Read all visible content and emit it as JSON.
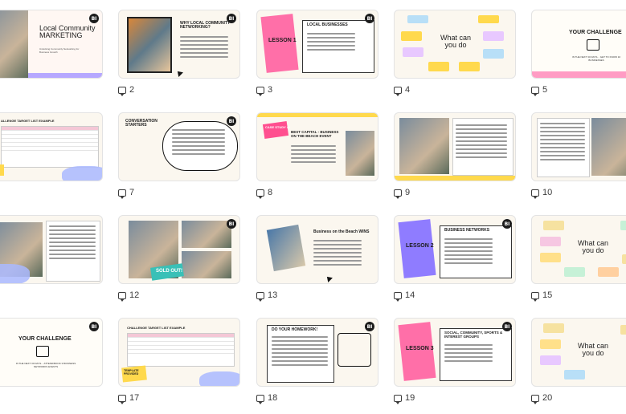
{
  "slides": [
    {
      "num": "",
      "title": "Local Community MARKETING",
      "subtitle": "Unlocking Community Networking for Business Growth",
      "kind": "cover"
    },
    {
      "num": "2",
      "title": "WHY LOCAL COMMUNITY NETWORKING?",
      "kind": "photo-text"
    },
    {
      "num": "3",
      "badge": "LESSON 1",
      "title": "LOCAL BUSINESSES",
      "items": [
        "Cafes & Restaurants",
        "Gyms & Fitness",
        "Retailers, Florists, Dry Cleaners",
        "Accountants, Lawyers, Professional Services",
        "Hairdressers, Businesses"
      ],
      "kind": "lesson"
    },
    {
      "num": "4",
      "center": "What can you do",
      "kind": "mindmap"
    },
    {
      "num": "5",
      "title": "YOUR CHALLENGE",
      "subtitle": "IN THE NEXT 30 DAYS... GET TO KNOW 10 BUSINESSES",
      "kind": "challenge"
    },
    {
      "num": "",
      "title": "ALLENGE TARGET LIST EXAMPLE",
      "kind": "table"
    },
    {
      "num": "7",
      "title": "CONVERSATION STARTERS",
      "kind": "speech"
    },
    {
      "num": "8",
      "badge": "CASE STUDY #1",
      "title": "BEST CAPITAL - BUSINESS ON THE BEACH EVENT",
      "kind": "casestudy"
    },
    {
      "num": "9",
      "kind": "screens"
    },
    {
      "num": "10",
      "kind": "screens2"
    },
    {
      "num": "",
      "kind": "people"
    },
    {
      "num": "12",
      "badge": "SOLD OUT!",
      "kind": "event"
    },
    {
      "num": "13",
      "title": "Business on the Beach WINS",
      "kind": "wins"
    },
    {
      "num": "14",
      "badge": "LESSON 2",
      "title": "BUSINESS NETWORKS",
      "kind": "lesson2"
    },
    {
      "num": "15",
      "center": "What can you do",
      "kind": "mindmap2"
    },
    {
      "num": "",
      "title": "YOUR CHALLENGE",
      "subtitle": "IN THE NEXT 30 DAYS... ATTEND/BOOK 3 BUSINESS NETWORKS EVENTS",
      "kind": "challenge2"
    },
    {
      "num": "17",
      "title": "CHALLENGE TARGET LIST EXAMPLE",
      "badge": "TEMPLATE PROVIDED",
      "kind": "table2"
    },
    {
      "num": "18",
      "title": "DO YOUR HOMEWORK!",
      "kind": "homework"
    },
    {
      "num": "19",
      "badge": "LESSON 3",
      "title": "SOCIAL, COMMUNITY, SPORTS & INTEREST GROUPS",
      "kind": "lesson3"
    },
    {
      "num": "20",
      "center": "What can you do",
      "kind": "mindmap3"
    }
  ],
  "logo": "BI",
  "colors": {
    "accent": "#7c5cff",
    "pink": "#ff6fa8",
    "yellow": "#ffd94d",
    "blue": "#a9b8ff"
  }
}
